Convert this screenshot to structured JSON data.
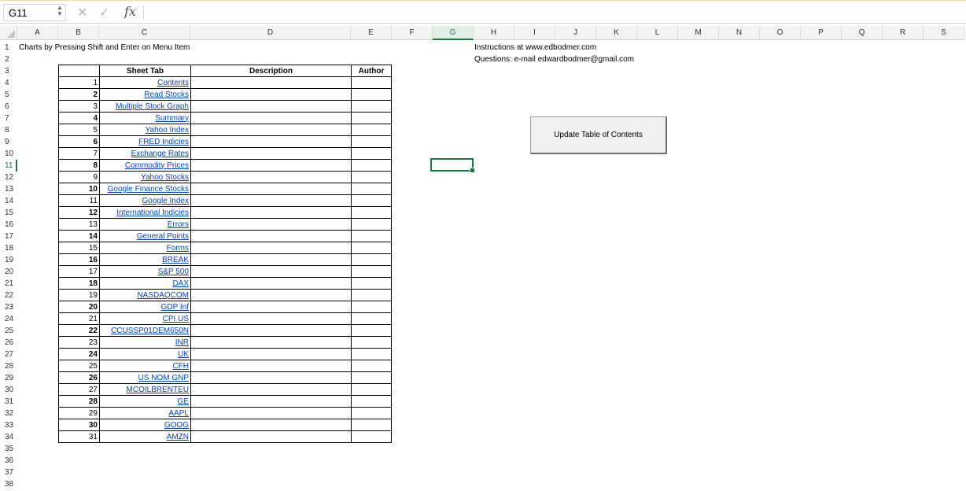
{
  "formula_bar": {
    "name_box": "G11",
    "cancel_icon": "✕",
    "enter_icon": "✓",
    "fx_label": "fx",
    "formula": ""
  },
  "columns": [
    "A",
    "B",
    "C",
    "D",
    "E",
    "F",
    "G",
    "H",
    "I",
    "J",
    "K",
    "L",
    "M",
    "N",
    "O",
    "P",
    "Q",
    "R",
    "S"
  ],
  "active_column": "G",
  "rows": [
    "1",
    "2",
    "3",
    "4",
    "5",
    "6",
    "7",
    "8",
    "9",
    "10",
    "11",
    "12",
    "13",
    "14",
    "15",
    "16",
    "17",
    "18",
    "19",
    "20",
    "21",
    "22",
    "23",
    "24",
    "25",
    "26",
    "27",
    "28",
    "29",
    "30",
    "31",
    "32",
    "33",
    "34",
    "35",
    "36",
    "37",
    "38"
  ],
  "active_row": "11",
  "cells": {
    "a1": "Charts by Pressing Shift and Enter on Menu Item",
    "h1": "Instructions at www.edbodmer.com",
    "h2": "Questions: e-mail edwardbodmer@gmail.com"
  },
  "toc": {
    "headers": {
      "sheet_tab": "Sheet Tab",
      "description": "Description",
      "author": "Author"
    },
    "rows": [
      {
        "num": "1",
        "tab": "Contents"
      },
      {
        "num": "2",
        "tab": "Read Stocks"
      },
      {
        "num": "3",
        "tab": "Multiple Stock Graph"
      },
      {
        "num": "4",
        "tab": "Summary"
      },
      {
        "num": "5",
        "tab": "Yahoo Index"
      },
      {
        "num": "6",
        "tab": "FRED Indicies"
      },
      {
        "num": "7",
        "tab": "Exchange Rates"
      },
      {
        "num": "8",
        "tab": "Commodity Prices"
      },
      {
        "num": "9",
        "tab": "Yahoo Stocks"
      },
      {
        "num": "10",
        "tab": "Google Finance Stocks"
      },
      {
        "num": "11",
        "tab": "Google Index"
      },
      {
        "num": "12",
        "tab": "International Indicies"
      },
      {
        "num": "13",
        "tab": "Errors"
      },
      {
        "num": "14",
        "tab": "General Points"
      },
      {
        "num": "15",
        "tab": "Forms"
      },
      {
        "num": "16",
        "tab": "BREAK"
      },
      {
        "num": "17",
        "tab": "S&P 500"
      },
      {
        "num": "18",
        "tab": "DAX"
      },
      {
        "num": "19",
        "tab": "NASDAQCOM"
      },
      {
        "num": "20",
        "tab": "GDP Inf"
      },
      {
        "num": "21",
        "tab": "CPI US"
      },
      {
        "num": "22",
        "tab": "CCUSSP01DEM650N"
      },
      {
        "num": "23",
        "tab": "INR"
      },
      {
        "num": "24",
        "tab": "UK"
      },
      {
        "num": "25",
        "tab": "CFH"
      },
      {
        "num": "26",
        "tab": "US NOM GNP"
      },
      {
        "num": "27",
        "tab": "MCOILBRENTEU"
      },
      {
        "num": "28",
        "tab": "GE"
      },
      {
        "num": "29",
        "tab": "AAPL"
      },
      {
        "num": "30",
        "tab": "GOOG"
      },
      {
        "num": "31",
        "tab": "AMZN"
      }
    ]
  },
  "update_button": "Update Table of Contents",
  "colors": {
    "accent": "#217346",
    "link": "#0645ad"
  }
}
